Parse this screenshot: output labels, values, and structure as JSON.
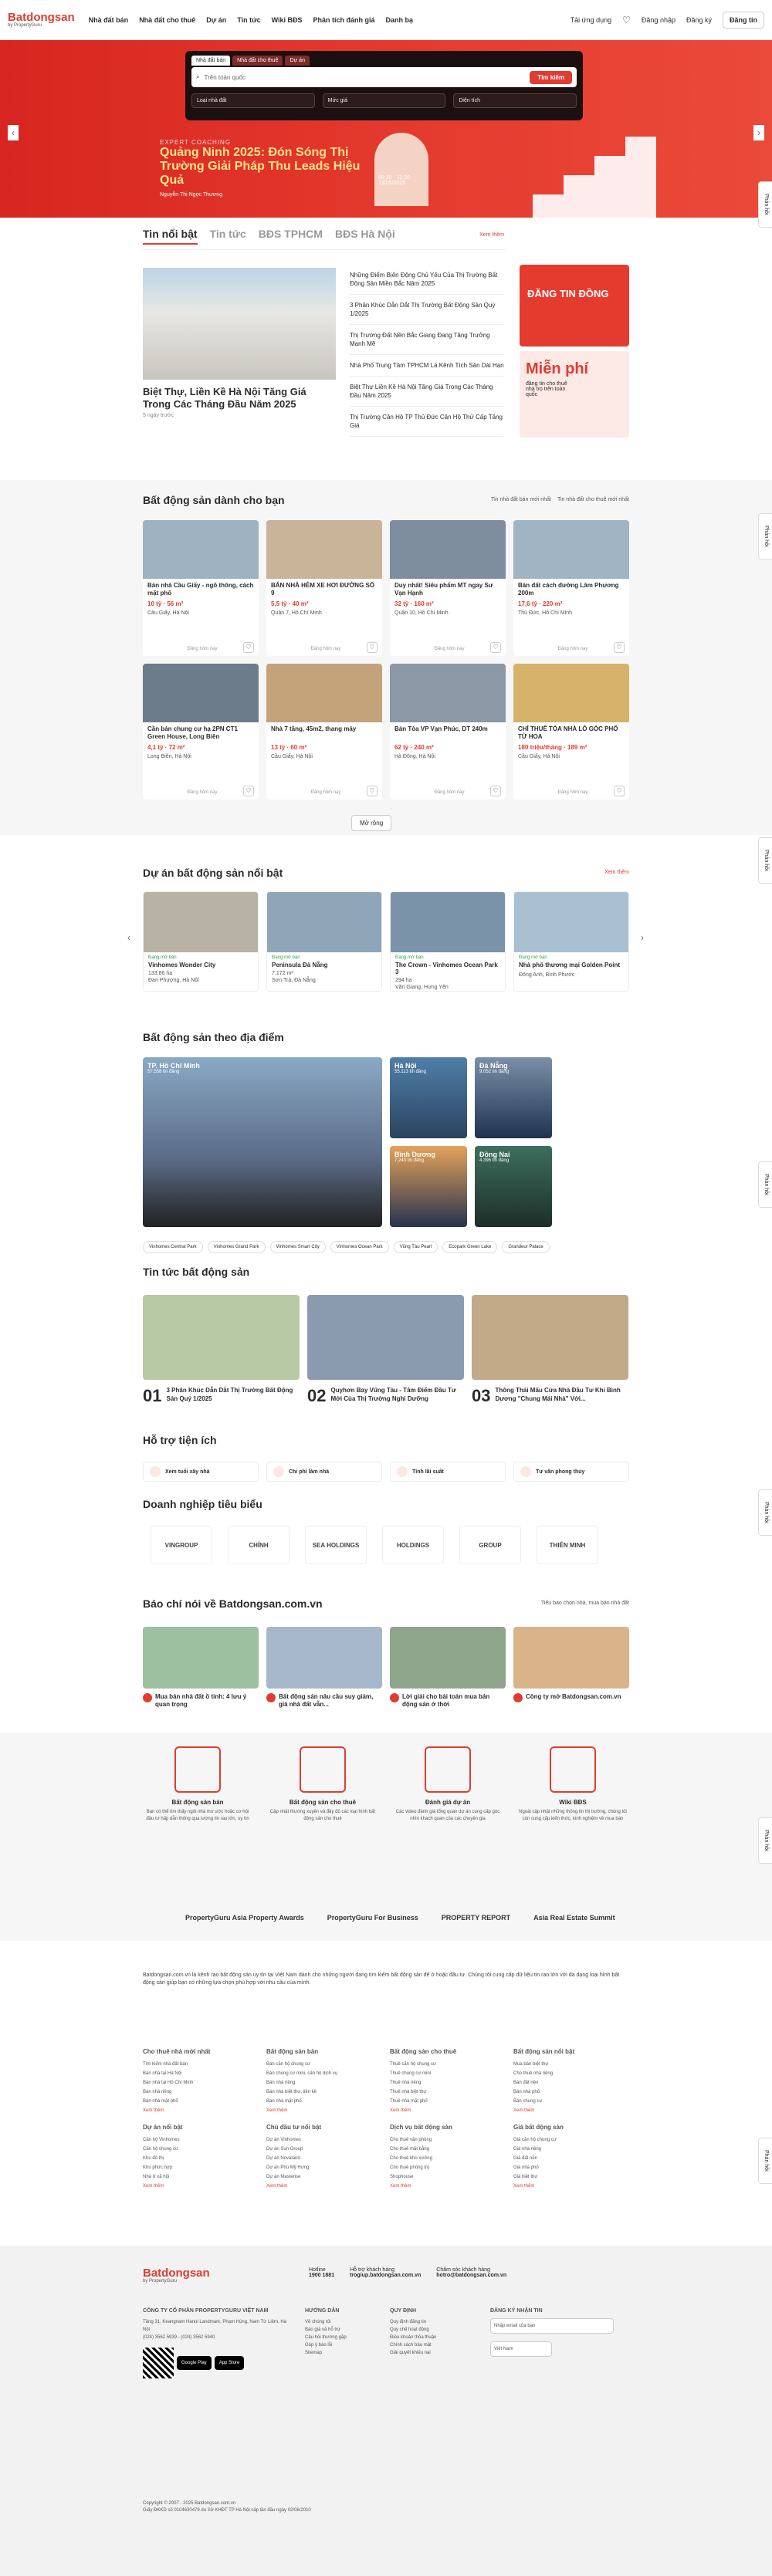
{
  "header": {
    "logo": "Batdongsan",
    "logo_sub": "by PropertyGuru",
    "nav": [
      "Nhà đất bán",
      "Nhà đất cho thuê",
      "Dự án",
      "Tin tức",
      "Wiki BĐS",
      "Phân tích đánh giá",
      "Danh bạ"
    ],
    "app": "Tải ứng dụng",
    "login": "Đăng nhập",
    "register": "Đăng ký",
    "post": "Đăng tin"
  },
  "search": {
    "tabs": [
      "Nhà đất bán",
      "Nhà đất cho thuê",
      "Dự án"
    ],
    "city": "Tìm kiếm",
    "placeholder": "Trên toàn quốc",
    "button": "Tìm kiếm",
    "filters": [
      "Loại nhà đất",
      "Mức giá",
      "Diện tích"
    ]
  },
  "hero": {
    "kicker": "EXPERT COACHING",
    "title": "Quảng Ninh 2025: Đón Sóng Thị Trường Giải Pháp Thu Leads Hiệu Quả",
    "date": "13/05/2025",
    "time": "08:30 - 11:30",
    "speaker": "Nguyễn Thị Ngọc Thương"
  },
  "side_tab": "Phản hồi",
  "news": {
    "tabs": [
      "Tin nổi bật",
      "Tin tức",
      "BĐS TPHCM",
      "BĐS Hà Nội"
    ],
    "more": "Xem thêm",
    "main_title": "Biệt Thự, Liền Kề Hà Nội Tăng Giá Trong Các Tháng Đầu Năm 2025",
    "main_time": "5 ngày trước",
    "list": [
      "Những Điểm Biến Động Chủ Yếu Của Thị Trường Bất Động Sản Miền Bắc Năm 2025",
      "3 Phân Khúc Dẫn Dắt Thị Trường Bất Động Sản Quý 1/2025",
      "Thị Trường Đất Nền Bắc Giang Đang Tăng Trưởng Mạnh Mẽ",
      "Nhà Phố Trung Tâm TPHCM Là Kênh Tích Sản Dài Hạn",
      "Biệt Thự Liền Kề Hà Nội Tăng Giá Trong Các Tháng Đầu Năm 2025",
      "Thị Trường Căn Hộ TP Thủ Đức Cân Hộ Thứ Cấp Tăng Giá"
    ],
    "ad1": "ĐĂNG TIN ĐỒNG",
    "ad2_title": "Miễn phí",
    "ad2_text": "đăng tin cho thuê nhà trọ trên toàn quốc"
  },
  "listings": {
    "title": "Bất động sản dành cho bạn",
    "link1": "Tin nhà đất bán mới nhất",
    "link2": "Tin nhà đất cho thuê mới nhất",
    "more": "Mở rộng",
    "items": [
      {
        "title": "Bán nhà Cầu Giấy - ngõ thông, cách mặt phố",
        "price": "10 tỷ",
        "area": "56 m²",
        "loc": "Cầu Giấy, Hà Nội",
        "time": "Đăng hôm nay"
      },
      {
        "title": "BÁN NHÀ HẺM XE HƠI ĐƯỜNG SỐ 9",
        "price": "5,5 tỷ",
        "area": "40 m²",
        "loc": "Quận 7, Hồ Chí Minh",
        "time": "Đăng hôm nay"
      },
      {
        "title": "Duy nhất! Siêu phẩm MT ngay Sư Vạn Hạnh",
        "price": "32 tỷ",
        "area": "160 m²",
        "loc": "Quận 10, Hồ Chí Minh",
        "time": "Đăng hôm nay"
      },
      {
        "title": "Bán đất cách đường Lâm Phương 200m",
        "price": "17,6 tỷ",
        "area": "220 m²",
        "loc": "Thủ Đức, Hồ Chí Minh",
        "time": "Đăng hôm nay"
      },
      {
        "title": "Cần bán chung cư hạ 2PN CT1 Green House, Long Biên",
        "price": "4,1 tỷ",
        "area": "72 m²",
        "loc": "Long Biên, Hà Nội",
        "time": "Đăng hôm nay"
      },
      {
        "title": "Nhà 7 tầng, 45m2, thang máy",
        "price": "13 tỷ",
        "area": "60 m²",
        "loc": "Cầu Giấy, Hà Nội",
        "time": "Đăng hôm nay"
      },
      {
        "title": "Bán Tòa VP Vạn Phúc, DT 240m",
        "price": "62 tỷ",
        "area": "240 m²",
        "loc": "Hà Đông, Hà Nội",
        "time": "Đăng hôm nay"
      },
      {
        "title": "CHỈ THUÊ TÒA NHÀ LÔ GÓC PHỐ TỪ HOA",
        "price": "180 triệu/tháng",
        "area": "189 m²",
        "loc": "Cầu Giấy, Hà Nội",
        "time": "Đăng hôm nay"
      }
    ]
  },
  "projects": {
    "title": "Dự án bất động sản nổi bật",
    "more": "Xem thêm",
    "items": [
      {
        "status": "Đang mở bán",
        "name": "Vinhomes Wonder City",
        "size": "133,86 ha",
        "loc": "Đan Phượng, Hà Nội"
      },
      {
        "status": "Đang mở bán",
        "name": "Peninsula Đà Nẵng",
        "size": "7.172 m²",
        "loc": "Sơn Trà, Đà Nẵng"
      },
      {
        "status": "Đang mở bán",
        "name": "The Crown - Vinhomes Ocean Park 3",
        "size": "294 ha",
        "loc": "Văn Giang, Hưng Yên"
      },
      {
        "status": "Đang mở bán",
        "name": "Nhà phố thương mại Golden Point",
        "size": "",
        "loc": "Đông Anh, Bình Phước"
      }
    ]
  },
  "locations": {
    "title": "Bất động sản theo địa điểm",
    "main": {
      "name": "TP. Hồ Chí Minh",
      "count": "57.558 tin đăng"
    },
    "cities": [
      {
        "name": "Hà Nội",
        "count": "55.113 tin đăng"
      },
      {
        "name": "Đà Nẵng",
        "count": "9.052 tin đăng"
      },
      {
        "name": "Bình Dương",
        "count": "7.243 tin đăng"
      },
      {
        "name": "Đồng Nai",
        "count": "4.396 tin đăng"
      }
    ],
    "tags": [
      "Vinhomes Central Park",
      "Vinhomes Grand Park",
      "Vinhomes Smart City",
      "Vinhomes Ocean Park",
      "Vũng Tàu Pearl",
      "Ecopark Green Lake",
      "Grandeur Palace"
    ]
  },
  "news2": {
    "title": "Tin tức bất động sản",
    "items": [
      {
        "num": "01",
        "title": "3 Phân Khúc Dẫn Dắt Thị Trường Bất Động Sản Quý 1/2025"
      },
      {
        "num": "02",
        "title": "Quyhơn Bay Vũng Tàu - Tâm Điểm Đầu Tư Mới Của Thị Trường Nghỉ Dưỡng"
      },
      {
        "num": "03",
        "title": "Thông Thái Mấu Cửa Nhà Đầu Tư Khi Bình Dương \"Chung Mái Nhà\" Với..."
      }
    ]
  },
  "tools": {
    "title": "Hỗ trợ tiện ích",
    "items": [
      "Xem tuổi xây nhà",
      "Chi phí làm nhà",
      "Tính lãi suất",
      "Tư vấn phong thủy"
    ]
  },
  "biz": {
    "title": "Doanh nghiệp tiêu biểu",
    "items": [
      "VINGROUP",
      "CHÍNH",
      "SEA HOLDINGS",
      "HOLDINGS",
      "GROUP",
      "THIÊN MINH"
    ]
  },
  "press": {
    "title": "Báo chí nói về Batdongsan.com.vn",
    "more": "Tiểu bao chọn nhà, mua bán nhà đất",
    "items": [
      "Mua bán nhà đất ồ tinh: 4 lưu ý quan trọng",
      "Bất động sản nâu cầu suy giảm, giá nhà đất vẫn...",
      "Lời giải cho bài toán mua bán động sản ở thời",
      "Công ty mở Batdongsan.com.vn"
    ]
  },
  "features": {
    "items": [
      {
        "name": "Bất động sản bán",
        "desc": "Bạn có thể tìm thấy ngôi nhà mơ ước hoặc cơ hội đầu tư hấp dẫn thông qua lượng tin rao lớn, uy tín"
      },
      {
        "name": "Bất động sản cho thuê",
        "desc": "Cập nhật thường xuyên và đầy đủ các loại hình bất động sản cho thuê"
      },
      {
        "name": "Đánh giá dự án",
        "desc": "Các video đánh giá tổng quan dự án cung cấp góc nhìn khách quan của các chuyên gia"
      },
      {
        "name": "Wiki BĐS",
        "desc": "Ngoài cập nhật những thông tin thị trường, chúng tôi còn cung cấp kiến thức, kinh nghiệm về mua bán"
      }
    ],
    "partners": [
      "PropertyGuru Asia Property Awards",
      "PropertyGuru For Business",
      "PROPERTY REPORT",
      "Asia Real Estate Summit"
    ]
  },
  "seo": {
    "intro": "Batdongsan.com.vn là kênh rao bất động sản uy tín tại Việt Nam dành cho những người đang tìm kiếm bất động sản để ở hoặc đầu tư. Chúng tôi cung cấp dữ liệu tin rao lớn với đa dạng loại hình bất động sản giúp bạn có những lựa chọn phù hợp với nhu cầu của mình.",
    "cols": [
      {
        "h": "Cho thuê nhà mới nhất",
        "items": [
          "Tìm kiếm nhà đất bán",
          "Bán nhà tại Hà Nội",
          "Bán nhà tại Hồ Chí Minh",
          "Bán nhà riêng",
          "Bán nhà mặt phố"
        ],
        "more": "Xem thêm"
      },
      {
        "h": "Bất động sản bán",
        "items": [
          "Bán căn hộ chung cư",
          "Bán chung cư mini, căn hộ dịch vụ",
          "Bán nhà riêng",
          "Bán nhà biệt thự, liền kề",
          "Bán nhà mặt phố"
        ],
        "more": "Xem thêm"
      },
      {
        "h": "Bất động sản cho thuê",
        "items": [
          "Thuê căn hộ chung cư",
          "Thuê chung cư mini",
          "Thuê nhà riêng",
          "Thuê nhà biệt thự",
          "Thuê nhà mặt phố"
        ],
        "more": "Xem thêm"
      },
      {
        "h": "Bất động sản nổi bật",
        "items": [
          "Mua bán biệt thự",
          "Cho thuê nhà riêng",
          "Bán đất nền",
          "Bán nhà phố",
          "Bán chung cư"
        ],
        "more": "Xem thêm"
      },
      {
        "h": "Dự án nổi bật",
        "items": [
          "Căn hộ Vinhomes",
          "Căn hộ chung cư",
          "Khu đô thị",
          "Khu phức hợp",
          "Nhà ở xã hội"
        ],
        "more": "Xem thêm"
      },
      {
        "h": "Chủ đầu tư nổi bật",
        "items": [
          "Dự án Vinhomes",
          "Dự án Sun Group",
          "Dự án Novaland",
          "Dự án Phú Mỹ Hưng",
          "Dự án Masterise"
        ],
        "more": "Xem thêm"
      },
      {
        "h": "Dịch vụ bất động sản",
        "items": [
          "Cho thuê văn phòng",
          "Cho thuê mặt bằng",
          "Cho thuê kho xưởng",
          "Cho thuê phòng trọ",
          "Shophouse"
        ],
        "more": "Xem thêm"
      },
      {
        "h": "Giá bất động sản",
        "items": [
          "Giá căn hộ chung cư",
          "Giá nhà riêng",
          "Giá đất nền",
          "Giá nhà phố",
          "Giá biệt thự"
        ],
        "more": "Xem thêm"
      }
    ]
  },
  "footer": {
    "logo": "Batdongsan",
    "logo_sub": "by PropertyGuru",
    "hotline_label": "Hotline",
    "hotline": "1900 1881",
    "support_label": "Hỗ trợ khách hàng",
    "support": "trogiup.batdongsan.com.vn",
    "cskh_label": "Chăm sóc khách hàng",
    "cskh": "hotro@batdongsan.com.vn",
    "company": "CÔNG TY CỔ PHẦN PROPERTYGURU VIỆT NAM",
    "address": "Tầng 31, Keangnam Hanoi Landmark, Phạm Hùng, Nam Từ Liêm, Hà Nội",
    "phone": "(024) 3562 5939 - (024) 3562 5940",
    "cols": [
      {
        "h": "HƯỚNG DẪN",
        "items": [
          "Về chúng tôi",
          "Báo giá và hỗ trợ",
          "Câu hỏi thường gặp",
          "Góp ý báo lỗi",
          "Sitemap"
        ]
      },
      {
        "h": "QUY ĐỊNH",
        "items": [
          "Quy định đăng tin",
          "Quy chế hoạt động",
          "Điều khoản thỏa thuận",
          "Chính sách bảo mật",
          "Giải quyết khiếu nại"
        ]
      },
      {
        "h": "ĐĂNG KÝ NHẬN TIN",
        "items": [
          "Nhập email của bạn"
        ]
      }
    ],
    "lang": "Việt Nam",
    "copyright": "Copyright © 2007 - 2025 Batdongsan.com.vn",
    "gp": "Giấy ĐKKD số 0104630479 do Sở KHĐT TP Hà Nội cấp lần đầu ngày 02/06/2010"
  }
}
